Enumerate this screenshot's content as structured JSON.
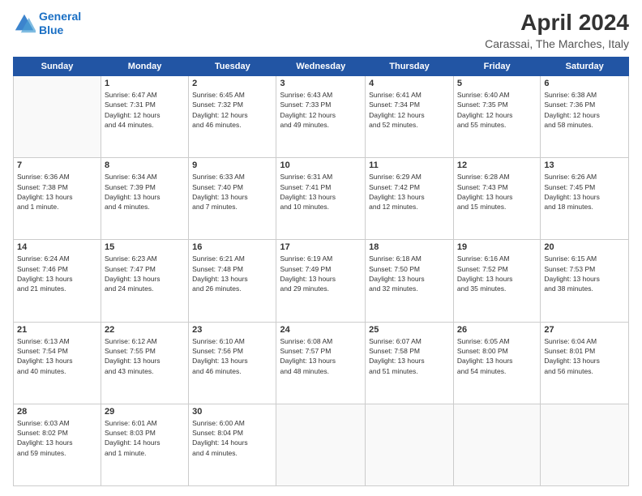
{
  "header": {
    "logo_line1": "General",
    "logo_line2": "Blue",
    "title": "April 2024",
    "subtitle": "Carassai, The Marches, Italy"
  },
  "days_of_week": [
    "Sunday",
    "Monday",
    "Tuesday",
    "Wednesday",
    "Thursday",
    "Friday",
    "Saturday"
  ],
  "weeks": [
    [
      {
        "day": "",
        "info": ""
      },
      {
        "day": "1",
        "info": "Sunrise: 6:47 AM\nSunset: 7:31 PM\nDaylight: 12 hours\nand 44 minutes."
      },
      {
        "day": "2",
        "info": "Sunrise: 6:45 AM\nSunset: 7:32 PM\nDaylight: 12 hours\nand 46 minutes."
      },
      {
        "day": "3",
        "info": "Sunrise: 6:43 AM\nSunset: 7:33 PM\nDaylight: 12 hours\nand 49 minutes."
      },
      {
        "day": "4",
        "info": "Sunrise: 6:41 AM\nSunset: 7:34 PM\nDaylight: 12 hours\nand 52 minutes."
      },
      {
        "day": "5",
        "info": "Sunrise: 6:40 AM\nSunset: 7:35 PM\nDaylight: 12 hours\nand 55 minutes."
      },
      {
        "day": "6",
        "info": "Sunrise: 6:38 AM\nSunset: 7:36 PM\nDaylight: 12 hours\nand 58 minutes."
      }
    ],
    [
      {
        "day": "7",
        "info": "Sunrise: 6:36 AM\nSunset: 7:38 PM\nDaylight: 13 hours\nand 1 minute."
      },
      {
        "day": "8",
        "info": "Sunrise: 6:34 AM\nSunset: 7:39 PM\nDaylight: 13 hours\nand 4 minutes."
      },
      {
        "day": "9",
        "info": "Sunrise: 6:33 AM\nSunset: 7:40 PM\nDaylight: 13 hours\nand 7 minutes."
      },
      {
        "day": "10",
        "info": "Sunrise: 6:31 AM\nSunset: 7:41 PM\nDaylight: 13 hours\nand 10 minutes."
      },
      {
        "day": "11",
        "info": "Sunrise: 6:29 AM\nSunset: 7:42 PM\nDaylight: 13 hours\nand 12 minutes."
      },
      {
        "day": "12",
        "info": "Sunrise: 6:28 AM\nSunset: 7:43 PM\nDaylight: 13 hours\nand 15 minutes."
      },
      {
        "day": "13",
        "info": "Sunrise: 6:26 AM\nSunset: 7:45 PM\nDaylight: 13 hours\nand 18 minutes."
      }
    ],
    [
      {
        "day": "14",
        "info": "Sunrise: 6:24 AM\nSunset: 7:46 PM\nDaylight: 13 hours\nand 21 minutes."
      },
      {
        "day": "15",
        "info": "Sunrise: 6:23 AM\nSunset: 7:47 PM\nDaylight: 13 hours\nand 24 minutes."
      },
      {
        "day": "16",
        "info": "Sunrise: 6:21 AM\nSunset: 7:48 PM\nDaylight: 13 hours\nand 26 minutes."
      },
      {
        "day": "17",
        "info": "Sunrise: 6:19 AM\nSunset: 7:49 PM\nDaylight: 13 hours\nand 29 minutes."
      },
      {
        "day": "18",
        "info": "Sunrise: 6:18 AM\nSunset: 7:50 PM\nDaylight: 13 hours\nand 32 minutes."
      },
      {
        "day": "19",
        "info": "Sunrise: 6:16 AM\nSunset: 7:52 PM\nDaylight: 13 hours\nand 35 minutes."
      },
      {
        "day": "20",
        "info": "Sunrise: 6:15 AM\nSunset: 7:53 PM\nDaylight: 13 hours\nand 38 minutes."
      }
    ],
    [
      {
        "day": "21",
        "info": "Sunrise: 6:13 AM\nSunset: 7:54 PM\nDaylight: 13 hours\nand 40 minutes."
      },
      {
        "day": "22",
        "info": "Sunrise: 6:12 AM\nSunset: 7:55 PM\nDaylight: 13 hours\nand 43 minutes."
      },
      {
        "day": "23",
        "info": "Sunrise: 6:10 AM\nSunset: 7:56 PM\nDaylight: 13 hours\nand 46 minutes."
      },
      {
        "day": "24",
        "info": "Sunrise: 6:08 AM\nSunset: 7:57 PM\nDaylight: 13 hours\nand 48 minutes."
      },
      {
        "day": "25",
        "info": "Sunrise: 6:07 AM\nSunset: 7:58 PM\nDaylight: 13 hours\nand 51 minutes."
      },
      {
        "day": "26",
        "info": "Sunrise: 6:05 AM\nSunset: 8:00 PM\nDaylight: 13 hours\nand 54 minutes."
      },
      {
        "day": "27",
        "info": "Sunrise: 6:04 AM\nSunset: 8:01 PM\nDaylight: 13 hours\nand 56 minutes."
      }
    ],
    [
      {
        "day": "28",
        "info": "Sunrise: 6:03 AM\nSunset: 8:02 PM\nDaylight: 13 hours\nand 59 minutes."
      },
      {
        "day": "29",
        "info": "Sunrise: 6:01 AM\nSunset: 8:03 PM\nDaylight: 14 hours\nand 1 minute."
      },
      {
        "day": "30",
        "info": "Sunrise: 6:00 AM\nSunset: 8:04 PM\nDaylight: 14 hours\nand 4 minutes."
      },
      {
        "day": "",
        "info": ""
      },
      {
        "day": "",
        "info": ""
      },
      {
        "day": "",
        "info": ""
      },
      {
        "day": "",
        "info": ""
      }
    ]
  ]
}
